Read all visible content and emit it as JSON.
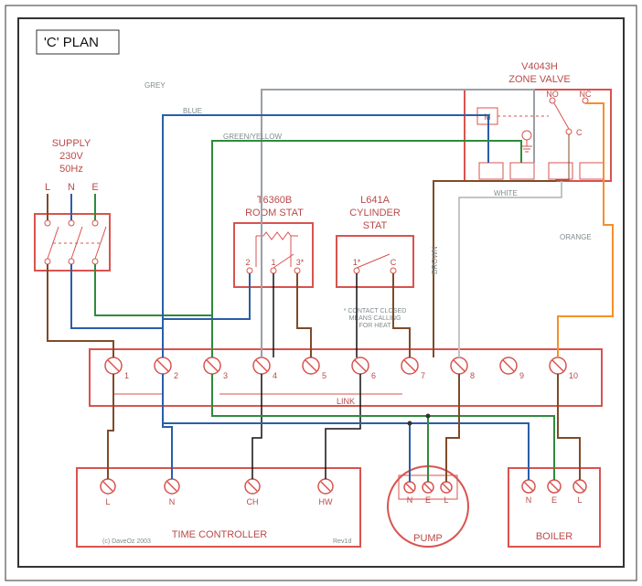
{
  "title": "'C' PLAN",
  "supply": {
    "label": "SUPPLY",
    "voltage": "230V",
    "hz": "50Hz",
    "L": "L",
    "N": "N",
    "E": "E"
  },
  "roomstat": {
    "label1": "T6360B",
    "label2": "ROOM STAT",
    "t1": "1",
    "t2": "2",
    "t3": "3*"
  },
  "cylstat": {
    "label1": "L641A",
    "label2": "CYLINDER",
    "label3": "STAT",
    "t1": "1*",
    "tC": "C",
    "note1": "* CONTACT CLOSED",
    "note2": "MEANS CALLING",
    "note3": "FOR HEAT"
  },
  "zonevalve": {
    "label1": "V4043H",
    "label2": "ZONE VALVE",
    "M": "M",
    "NO": "NO",
    "NC": "NC",
    "C": "C"
  },
  "junction": {
    "t1": "1",
    "t2": "2",
    "t3": "3",
    "t4": "4",
    "t5": "5",
    "t6": "6",
    "t7": "7",
    "t8": "8",
    "t9": "9",
    "t10": "10",
    "link": "LINK"
  },
  "timecontroller": {
    "label": "TIME CONTROLLER",
    "L": "L",
    "N": "N",
    "CH": "CH",
    "HW": "HW",
    "credit": "(c) DaveOz 2003",
    "rev": "Rev1d"
  },
  "pump": {
    "label": "PUMP",
    "N": "N",
    "E": "E",
    "L": "L"
  },
  "boiler": {
    "label": "BOILER",
    "N": "N",
    "E": "E",
    "L": "L"
  },
  "wires": {
    "grey": "GREY",
    "blue": "BLUE",
    "greenyellow": "GREEN/YELLOW",
    "brown": "BROWN",
    "white": "WHITE",
    "orange": "ORANGE"
  }
}
